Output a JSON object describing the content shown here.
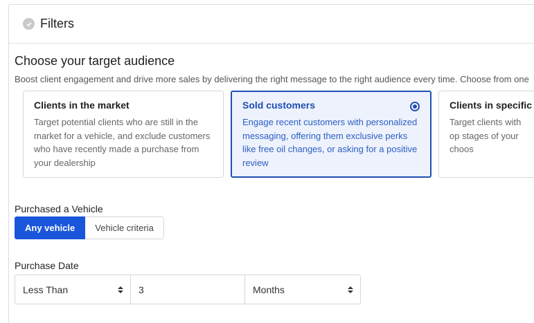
{
  "panel": {
    "title": "Filters",
    "icon": "check-circle-icon"
  },
  "audience": {
    "title": "Choose your target audience",
    "description": "Boost client engagement and drive more sales by delivering the right message to the right audience every time. Choose from one",
    "cards": [
      {
        "title": "Clients in the market",
        "description": "Target potential clients who are still in the market for a vehicle, and exclude customers who have recently made a purchase from your dealership",
        "selected": false
      },
      {
        "title": "Sold customers",
        "description": "Engage recent customers with personalized messaging, offering them exclusive perks like free oil changes, or asking for a positive review",
        "selected": true
      },
      {
        "title": "Clients in specific s",
        "description": "Target clients with op stages of your choos",
        "selected": false
      }
    ]
  },
  "purchased_vehicle": {
    "label": "Purchased a Vehicle",
    "options": [
      "Any vehicle",
      "Vehicle criteria"
    ],
    "selected": "Any vehicle"
  },
  "purchase_date": {
    "label": "Purchase Date",
    "comparator": "Less Than",
    "amount": "3",
    "unit": "Months"
  },
  "colors": {
    "accent": "#1a56db",
    "selected_border": "#1f4fb3",
    "selected_bg": "#edf2fc"
  }
}
